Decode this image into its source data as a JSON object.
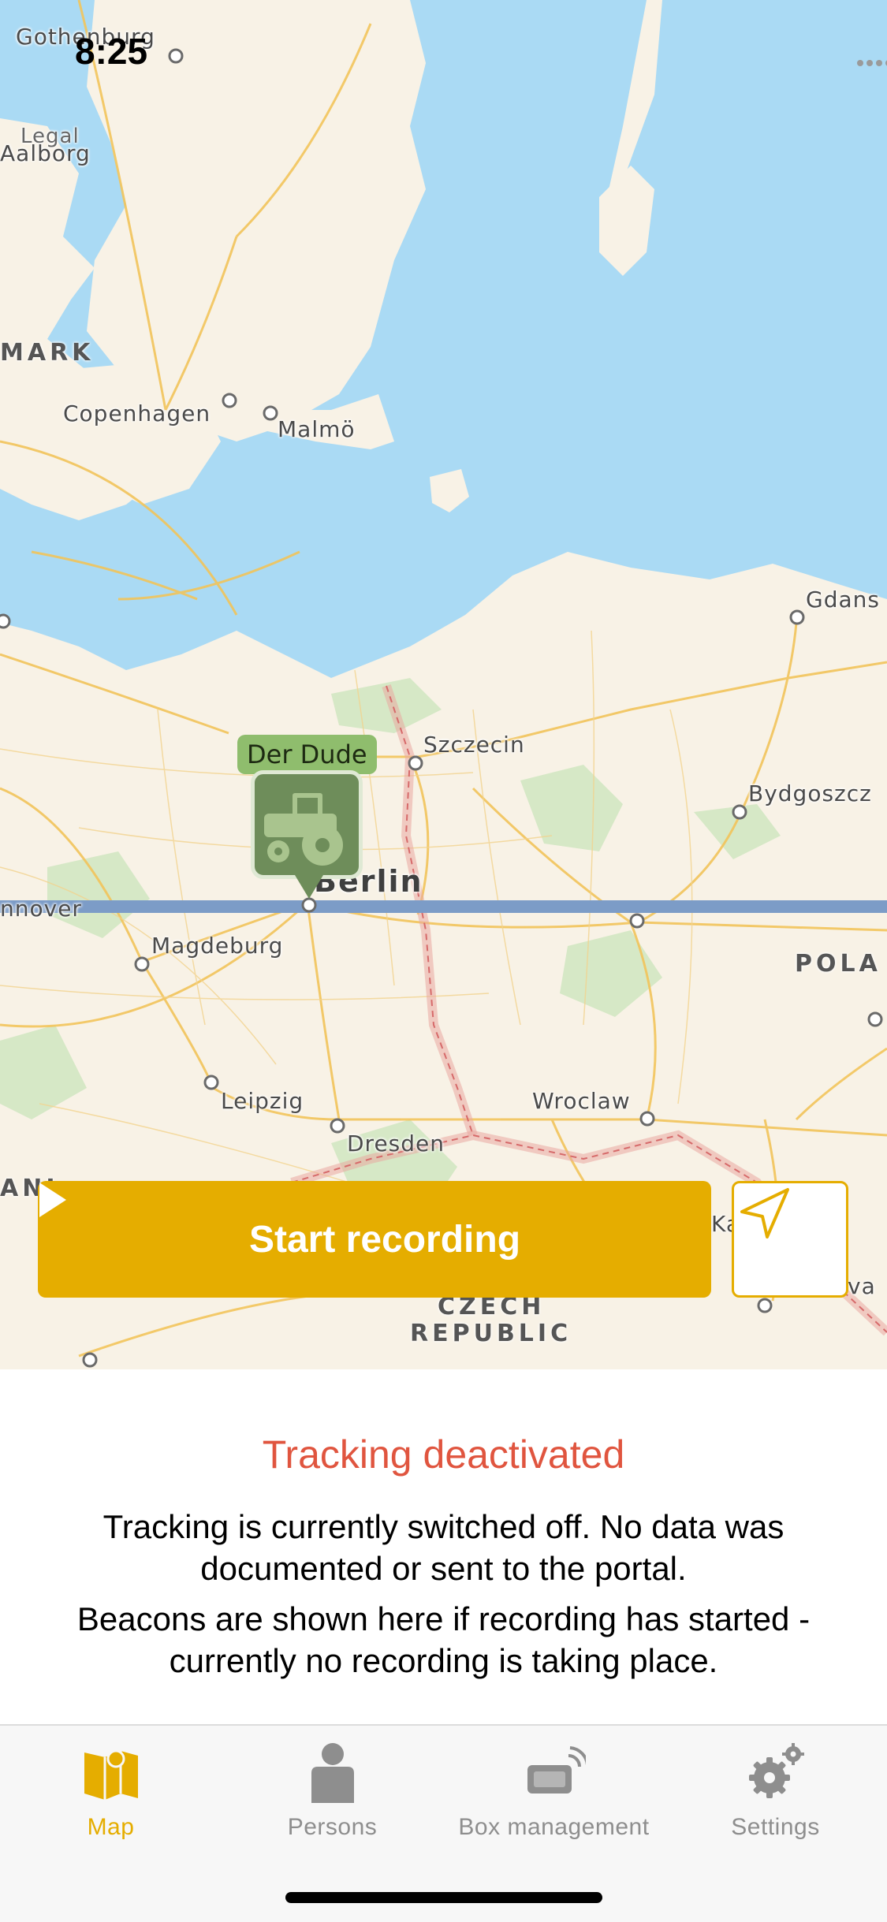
{
  "status_bar": {
    "time": "8:25"
  },
  "map": {
    "labels": {
      "gothenburg": "Gothenburg",
      "legal": "Legal",
      "aalborg": "Aalborg",
      "mark": "MARK",
      "copenhagen": "Copenhagen",
      "malmo": "Malmö",
      "gdansk": "Gdans",
      "szczecin": "Szczecin",
      "bydgoszcz": "Bydgoszcz",
      "berlin": "Berlin",
      "hannover": "nnover",
      "magdeburg": "Magdeburg",
      "pola": "POLA",
      "leipzig": "Leipzig",
      "wroclaw": "Wroclaw",
      "dresden": "Dresden",
      "ani": "ANI",
      "czech": "CZECH",
      "republic": "REPUBLIC",
      "ka": "Ka",
      "va": "va"
    },
    "vehicle_marker": {
      "label": "Der Dude",
      "icon": "tractor-icon"
    }
  },
  "controls": {
    "start_recording_label": "Start recording",
    "locate_icon": "location-arrow-icon"
  },
  "info": {
    "title": "Tracking deactivated",
    "text1": "Tracking is currently switched off. No data was documented or sent to the portal.",
    "text2": "Beacons are shown here if recording has started - currently no recording is taking place."
  },
  "tabbar": {
    "tabs": [
      {
        "label": "Map",
        "icon": "map-icon",
        "active": true
      },
      {
        "label": "Persons",
        "icon": "person-icon",
        "active": false
      },
      {
        "label": "Box management",
        "icon": "box-icon",
        "active": false
      },
      {
        "label": "Settings",
        "icon": "gears-icon",
        "active": false
      }
    ]
  },
  "colors": {
    "accent": "#e5ad00",
    "warning_text": "#e0553f",
    "water": "#aadaf4",
    "land": "#f8f2e6",
    "route": "#7c9cc7",
    "marker_green": "#6e8d5a"
  }
}
